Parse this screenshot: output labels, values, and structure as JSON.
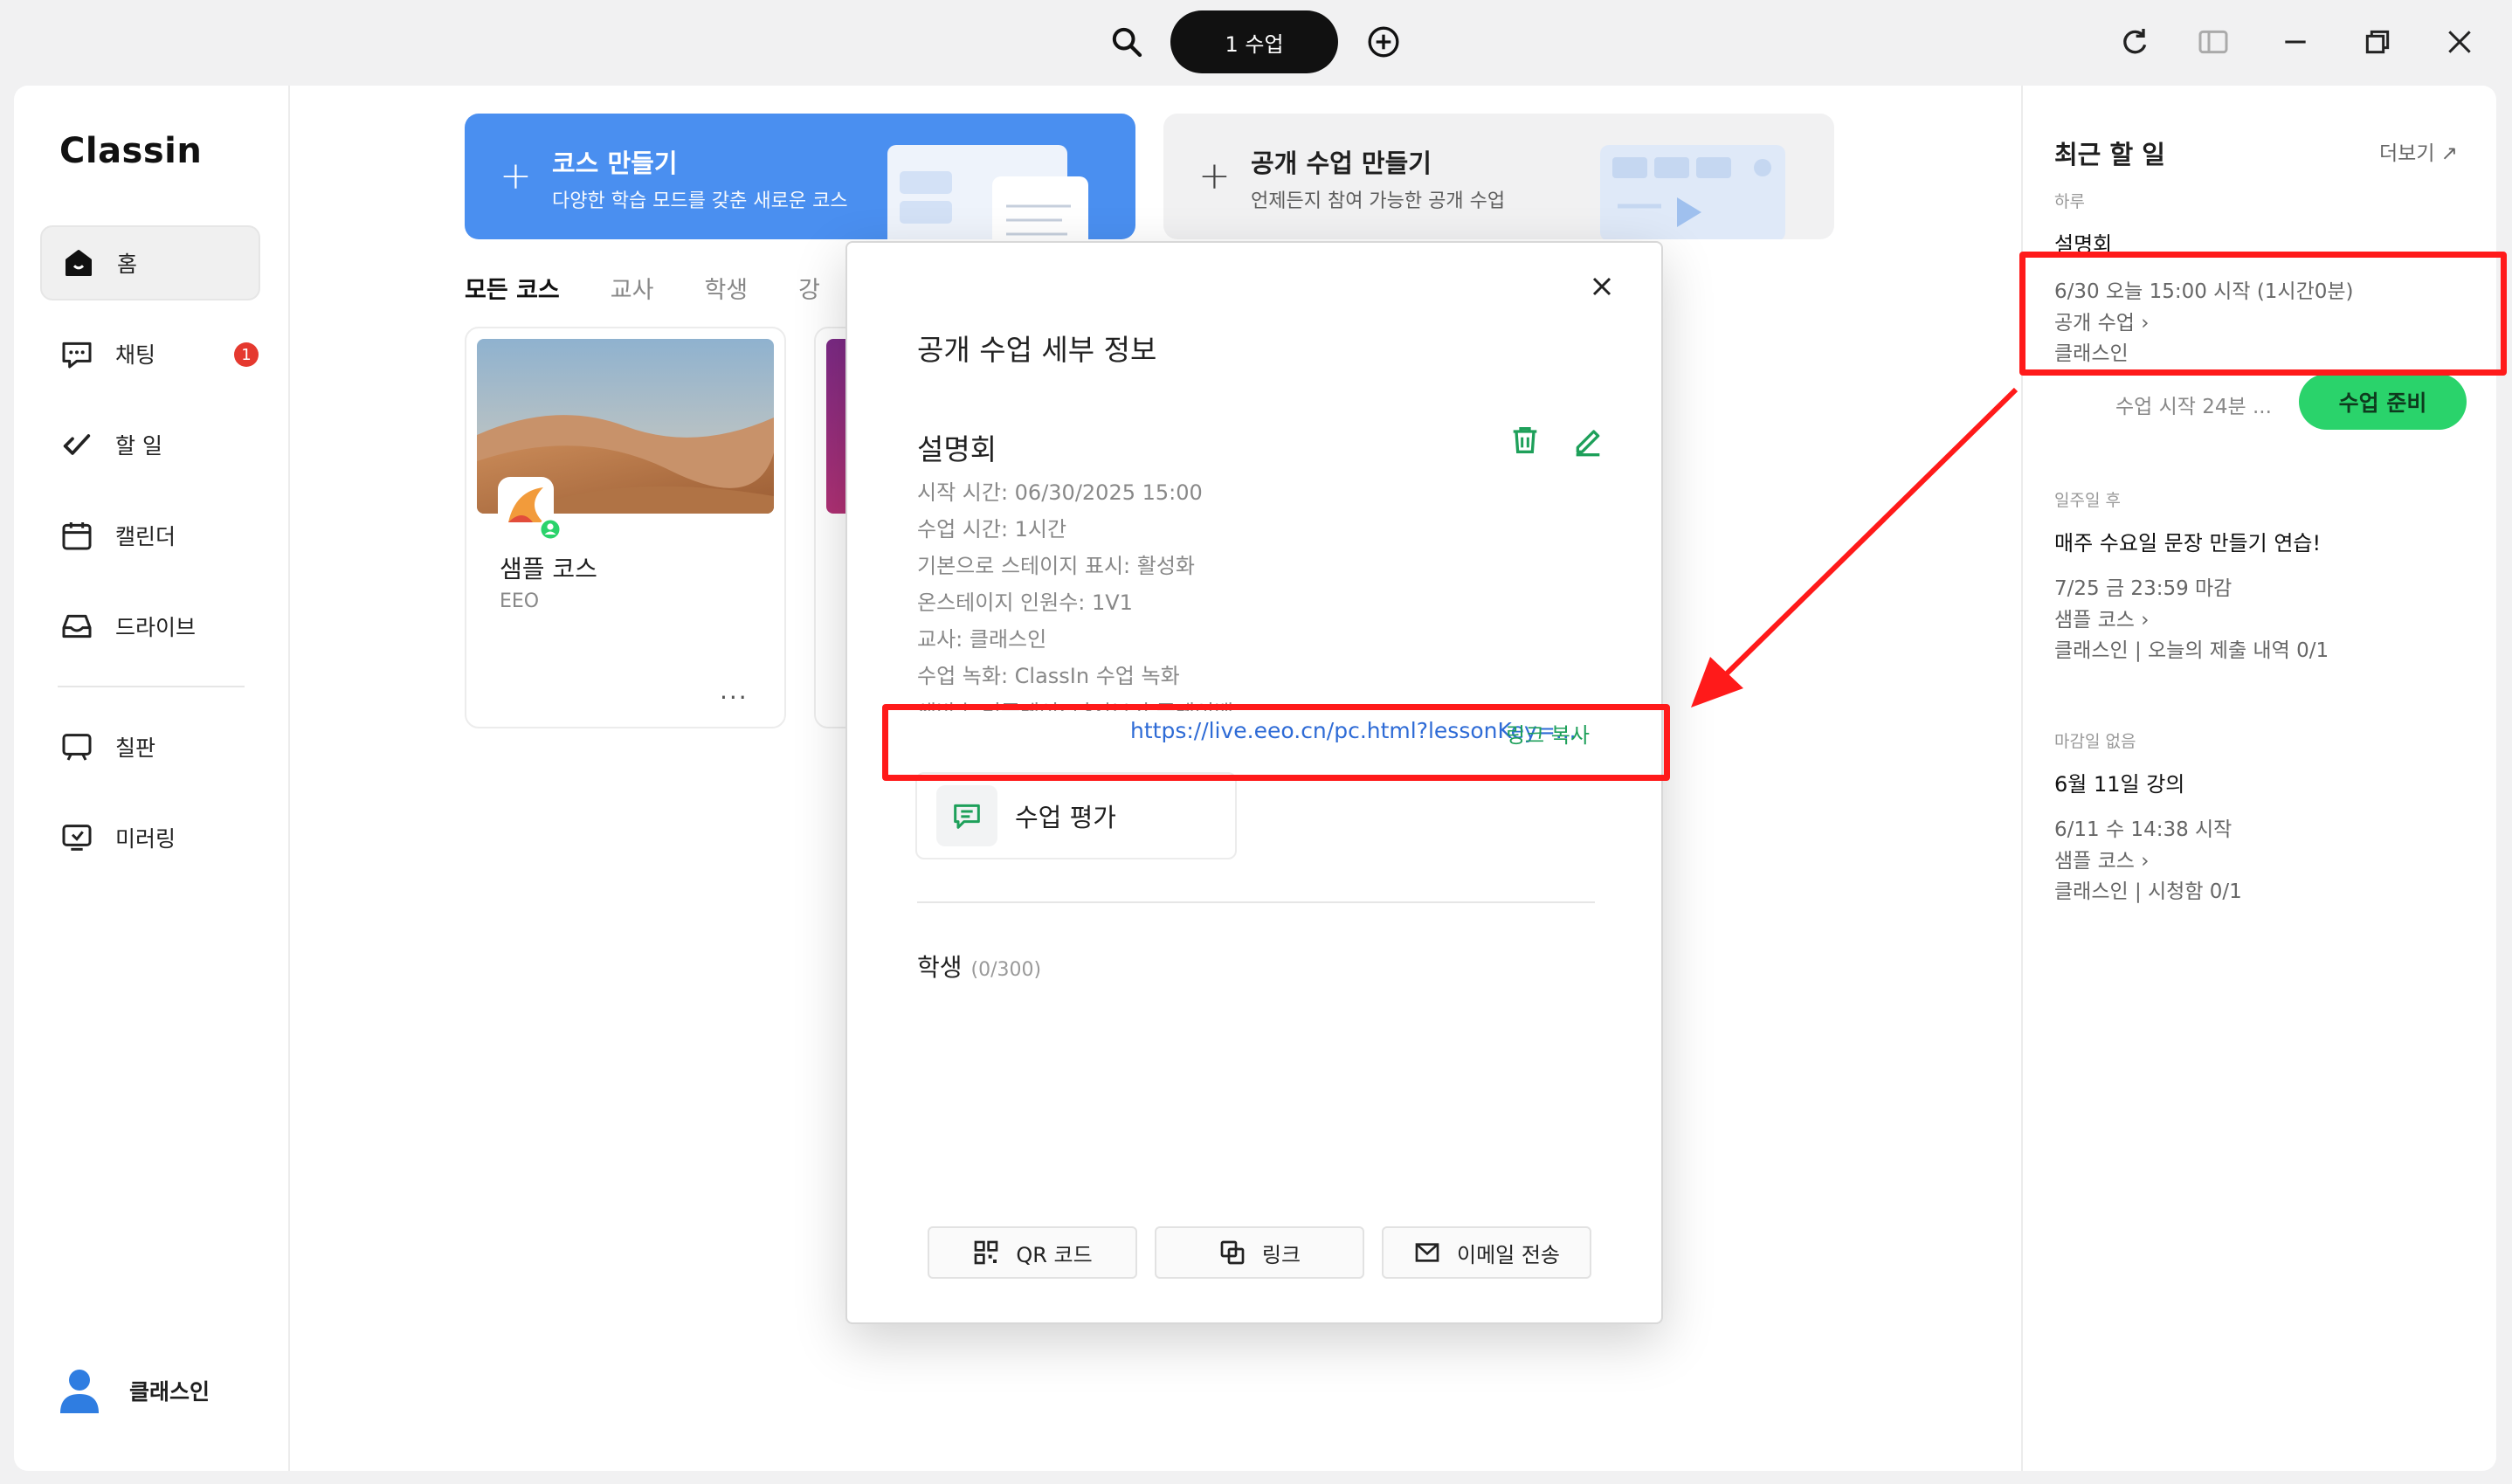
{
  "titlebar": {
    "class_pill": "1 수업",
    "icons": [
      "search-icon",
      "add-circle-icon",
      "refresh-icon",
      "sidebar-toggle-icon",
      "minimize-icon",
      "restore-icon",
      "close-icon"
    ]
  },
  "sidebar": {
    "logo": "Classin",
    "items": [
      {
        "label": "홈",
        "icon": "home-icon"
      },
      {
        "label": "채팅",
        "icon": "chat-icon",
        "badge": "1"
      },
      {
        "label": "할 일",
        "icon": "todo-icon"
      },
      {
        "label": "캘린더",
        "icon": "calendar-icon"
      },
      {
        "label": "드라이브",
        "icon": "drive-icon"
      },
      {
        "label": "칠판",
        "icon": "blackboard-icon"
      },
      {
        "label": "미러링",
        "icon": "mirroring-icon"
      }
    ],
    "user": "클래스인"
  },
  "main": {
    "banners": [
      {
        "title": "코스 만들기",
        "subtitle": "다양한 학습 모드를 갖춘 새로운 코스"
      },
      {
        "title": "공개 수업 만들기",
        "subtitle": "언제든지 참여 가능한 공개 수업"
      }
    ],
    "tabs": [
      "모든 코스",
      "교사",
      "학생",
      "강"
    ],
    "course_card": {
      "title": "샘플 코스",
      "org": "EEO",
      "more": "..."
    }
  },
  "right_panel": {
    "title": "최근 할 일",
    "more": "더보기",
    "sections": [
      {
        "label": "하루",
        "title": "설명회",
        "lines": [
          "6/30 오늘 15:00 시작 (1시간0분)",
          "공개 수업 ›",
          "클래스인"
        ],
        "start_in": "수업 시작 24분 ...",
        "button": "수업 준비"
      },
      {
        "label": "일주일 후",
        "title": "매주 수요일 문장 만들기 연습!",
        "lines": [
          "7/25 금 23:59 마감",
          "샘플 코스 ›",
          "클래스인 | 오늘의 제출 내역 0/1"
        ]
      },
      {
        "label": "마감일 없음",
        "title": "6월 11일 강의",
        "lines": [
          "6/11 수 14:38 시작",
          "샘플 코스 ›",
          "클래스인 | 시청함 0/1"
        ]
      }
    ]
  },
  "modal": {
    "title": "공개 수업 세부 정보",
    "lesson_name": "설명회",
    "details": [
      "시작 시간: 06/30/2025 15:00",
      "수업 시간: 1시간",
      "기본으로 스테이지 표시: 활성화",
      "온스테이지 인원수: 1V1",
      "교사: 클래스인",
      "수업 녹화: ClassIn 수업 녹화",
      "생방송 리플레이: 다시보기 플레이백"
    ],
    "link": "https://live.eeo.cn/pc.html?lessonKey=...",
    "copy_link": "링크 복사",
    "evaluation": "수업 평가",
    "students_label": "학생",
    "students_count": "(0/300)",
    "footer_buttons": [
      "QR 코드",
      "링크",
      "이메일 전송"
    ]
  },
  "colors": {
    "accent_blue": "#4a8ff0",
    "accent_green": "#2ad36b",
    "annotation_red": "#ff1a1a",
    "link_blue": "#2e6bd6"
  }
}
